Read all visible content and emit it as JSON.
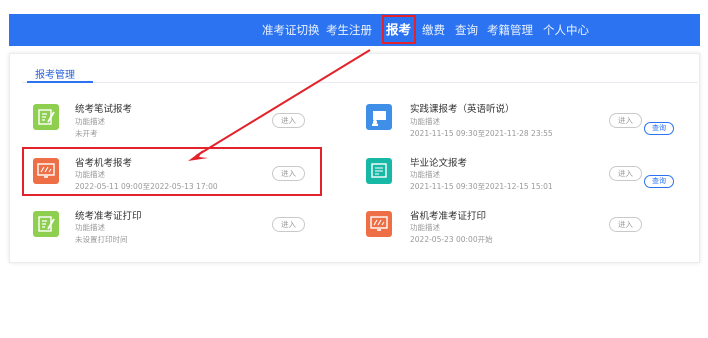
{
  "nav": {
    "items": [
      "准考证切换",
      "考生注册",
      "报考",
      "缴费",
      "查询",
      "考籍管理",
      "个人中心"
    ],
    "active": "报考"
  },
  "panel": {
    "tab": "报考管理"
  },
  "cards": [
    {
      "title": "统考笔试报考",
      "desc": "功能描述",
      "status": "未开考",
      "button": "进入",
      "icon": "green-write-icon"
    },
    {
      "title": "实践课报考（英语听说）",
      "desc": "功能描述",
      "status": "2021-11-15 09:30至2021-11-28 23:55",
      "button": "进入",
      "query": "查询",
      "icon": "blue-teacher-icon"
    },
    {
      "title": "省考机考报考",
      "desc": "功能描述",
      "status": "2022-05-11 09:00至2022-05-13 17:00",
      "button": "进入",
      "icon": "orange-monitor-icon"
    },
    {
      "title": "毕业论文报考",
      "desc": "功能描述",
      "status": "2021-11-15 09:30至2021-12-15 15:01",
      "button": "进入",
      "query": "查询",
      "icon": "teal-certificate-icon"
    },
    {
      "title": "统考准考证打印",
      "desc": "功能描述",
      "status": "未设置打印时间",
      "button": "进入",
      "icon": "green-write-icon"
    },
    {
      "title": "省机考准考证打印",
      "desc": "功能描述",
      "status": "2022-05-23 00:00开始",
      "button": "进入",
      "icon": "orange-monitor-icon"
    }
  ],
  "colors": {
    "nav_bg": "#2b73f1",
    "highlight": "#e3222b",
    "green": "#8fcf4f",
    "blue": "#3f8ee8",
    "orange": "#ee6f45",
    "teal": "#17b8a6"
  }
}
